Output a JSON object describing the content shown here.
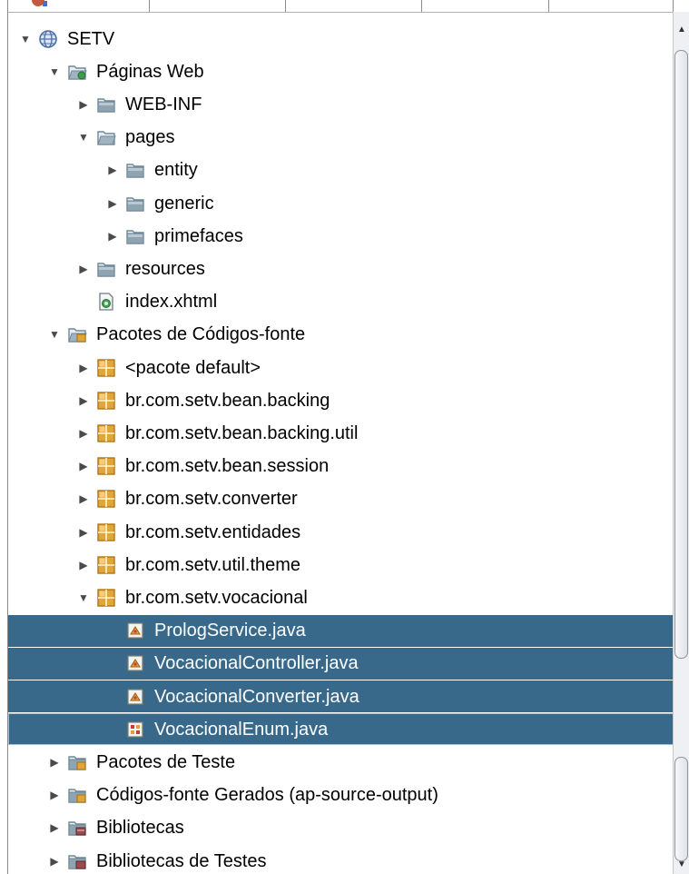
{
  "tree": {
    "rows": [
      {
        "label": "SETV",
        "level": 0,
        "toggle": "open",
        "icon": "globe-project-icon"
      },
      {
        "label": "Páginas Web",
        "level": 1,
        "toggle": "open",
        "icon": "web-pages-folder-icon"
      },
      {
        "label": "WEB-INF",
        "level": 2,
        "toggle": "closed",
        "icon": "folder-icon"
      },
      {
        "label": "pages",
        "level": 2,
        "toggle": "open",
        "icon": "folder-open-icon"
      },
      {
        "label": "entity",
        "level": 3,
        "toggle": "closed",
        "icon": "folder-icon"
      },
      {
        "label": "generic",
        "level": 3,
        "toggle": "closed",
        "icon": "folder-icon"
      },
      {
        "label": "primefaces",
        "level": 3,
        "toggle": "closed",
        "icon": "folder-icon"
      },
      {
        "label": "resources",
        "level": 2,
        "toggle": "closed",
        "icon": "folder-icon"
      },
      {
        "label": "index.xhtml",
        "level": 2,
        "toggle": "none",
        "icon": "xhtml-file-icon"
      },
      {
        "label": "Pacotes de Códigos-fonte",
        "level": 1,
        "toggle": "open",
        "icon": "source-packages-icon"
      },
      {
        "label": "<pacote default>",
        "level": 2,
        "toggle": "closed",
        "icon": "package-icon"
      },
      {
        "label": "br.com.setv.bean.backing",
        "level": 2,
        "toggle": "closed",
        "icon": "package-icon"
      },
      {
        "label": "br.com.setv.bean.backing.util",
        "level": 2,
        "toggle": "closed",
        "icon": "package-icon"
      },
      {
        "label": "br.com.setv.bean.session",
        "level": 2,
        "toggle": "closed",
        "icon": "package-icon"
      },
      {
        "label": "br.com.setv.converter",
        "level": 2,
        "toggle": "closed",
        "icon": "package-icon"
      },
      {
        "label": "br.com.setv.entidades",
        "level": 2,
        "toggle": "closed",
        "icon": "package-icon"
      },
      {
        "label": "br.com.setv.util.theme",
        "level": 2,
        "toggle": "closed",
        "icon": "package-icon"
      },
      {
        "label": "br.com.setv.vocacional",
        "level": 2,
        "toggle": "open",
        "icon": "package-icon"
      },
      {
        "label": "PrologService.java",
        "level": 3,
        "toggle": "none",
        "icon": "java-class-icon",
        "selected": true
      },
      {
        "label": "VocacionalController.java",
        "level": 3,
        "toggle": "none",
        "icon": "java-class-icon",
        "selected": true
      },
      {
        "label": "VocacionalConverter.java",
        "level": 3,
        "toggle": "none",
        "icon": "java-class-icon",
        "selected": true
      },
      {
        "label": "VocacionalEnum.java",
        "level": 3,
        "toggle": "none",
        "icon": "java-enum-icon",
        "selected": true,
        "focused": true
      },
      {
        "label": "Pacotes de Teste",
        "level": 1,
        "toggle": "closed",
        "icon": "test-packages-icon"
      },
      {
        "label": "Códigos-fonte Gerados (ap-source-output)",
        "level": 1,
        "toggle": "closed",
        "icon": "generated-sources-icon"
      },
      {
        "label": "Bibliotecas",
        "level": 1,
        "toggle": "closed",
        "icon": "libraries-icon"
      },
      {
        "label": "Bibliotecas de Testes",
        "level": 1,
        "toggle": "closed",
        "icon": "test-libraries-icon"
      }
    ]
  },
  "colors": {
    "selection": "#39698a",
    "selection_text": "#ffffff",
    "folder": "#6f8797",
    "package": "#e0a63a"
  }
}
